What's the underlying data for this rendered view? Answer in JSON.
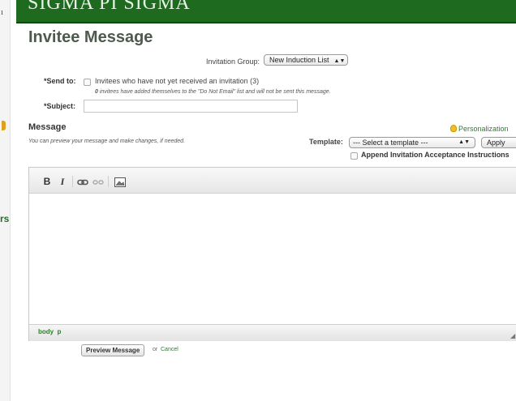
{
  "left_fragments": {
    "top_glyph": "ı",
    "side_word": "rs"
  },
  "banner": {
    "org_name": "SIGMA PI SIGMA"
  },
  "page": {
    "title": "Invitee Message"
  },
  "invitation_group": {
    "label": "Invitation Group:",
    "selected": "New Induction List"
  },
  "send_to": {
    "label": "*Send to:",
    "option": "Invitees who have not yet received an invitation (3)",
    "note_count": "0",
    "note_text": " invitees have added themselves to the \"Do Not Email\" list and will not be sent this message."
  },
  "subject": {
    "label": "*Subject:",
    "value": ""
  },
  "message": {
    "heading": "Message",
    "help": "You can preview your message and make changes, if needed.",
    "personalize": "Personalization"
  },
  "template": {
    "label": "Template:",
    "selected": "--- Select a template ---",
    "apply": "Apply",
    "append_label": "Append Invitation Acceptance Instructions"
  },
  "editor": {
    "buttons": {
      "bold": "B",
      "italic": "I"
    },
    "status_path": "body  p",
    "content": ""
  },
  "actions": {
    "preview": "Preview Message",
    "or": "or",
    "cancel": "Cancel"
  },
  "colors": {
    "brand_green": "#1e6a1e",
    "link_green": "#2b7d2b",
    "title_gray": "#4f5a4f"
  },
  "icons": [
    "lightbulb-icon",
    "bold-icon",
    "italic-icon",
    "link-icon",
    "unlink-icon",
    "image-icon",
    "resize-icon",
    "dropdown-arrow-icon"
  ]
}
